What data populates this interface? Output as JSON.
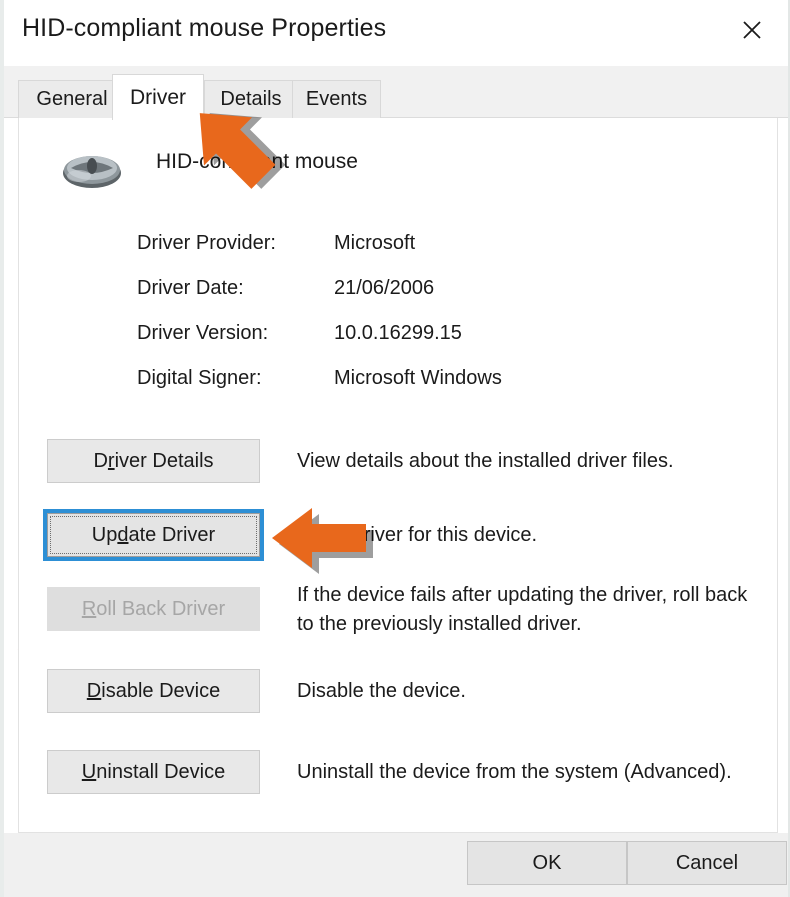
{
  "window": {
    "title": "HID-compliant mouse Properties",
    "close_icon": "close-icon"
  },
  "tabs": [
    {
      "label": "General",
      "active": false
    },
    {
      "label": "Driver",
      "active": true
    },
    {
      "label": "Details",
      "active": false
    },
    {
      "label": "Events",
      "active": false
    }
  ],
  "device": {
    "icon": "mouse-icon",
    "name": "HID-compliant mouse"
  },
  "driver_info": [
    {
      "label": "Driver Provider:",
      "value": "Microsoft"
    },
    {
      "label": "Driver Date:",
      "value": "21/06/2006"
    },
    {
      "label": "Driver Version:",
      "value": "10.0.16299.15"
    },
    {
      "label": "Digital Signer:",
      "value": "Microsoft Windows"
    }
  ],
  "actions": [
    {
      "label": "Driver Details",
      "accel_index": 1,
      "description": "View details about the installed driver files.",
      "state": "enabled"
    },
    {
      "label": "Update Driver",
      "accel_index": 2,
      "description": "te the driver for this device.",
      "state": "focused"
    },
    {
      "label": "Roll Back Driver",
      "accel_index": 0,
      "description": "If the device fails after updating the driver, roll back to the previously installed driver.",
      "state": "disabled"
    },
    {
      "label": "Disable Device",
      "accel_index": 0,
      "description": "Disable the device.",
      "state": "enabled"
    },
    {
      "label": "Uninstall Device",
      "accel_index": 0,
      "description": "Uninstall the device from the system (Advanced).",
      "state": "enabled"
    }
  ],
  "footer": {
    "ok_label": "OK",
    "cancel_label": "Cancel"
  },
  "annotations": [
    {
      "name": "arrow-pointing-to-driver-tab",
      "color": "#e8681c",
      "direction": "up-left"
    },
    {
      "name": "arrow-pointing-to-update-driver-button",
      "color": "#e8681c",
      "direction": "left"
    }
  ],
  "colors": {
    "accent_arrow": "#e8681c",
    "focus_border": "#2d8fd5",
    "dialog_bg": "#ffffff",
    "tabstrip_bg": "#f1f1f1",
    "footer_bg": "#f0f0f0",
    "button_bg": "#e8e8e8",
    "text": "#1b1b1b",
    "disabled_text": "#a6a6a6"
  }
}
